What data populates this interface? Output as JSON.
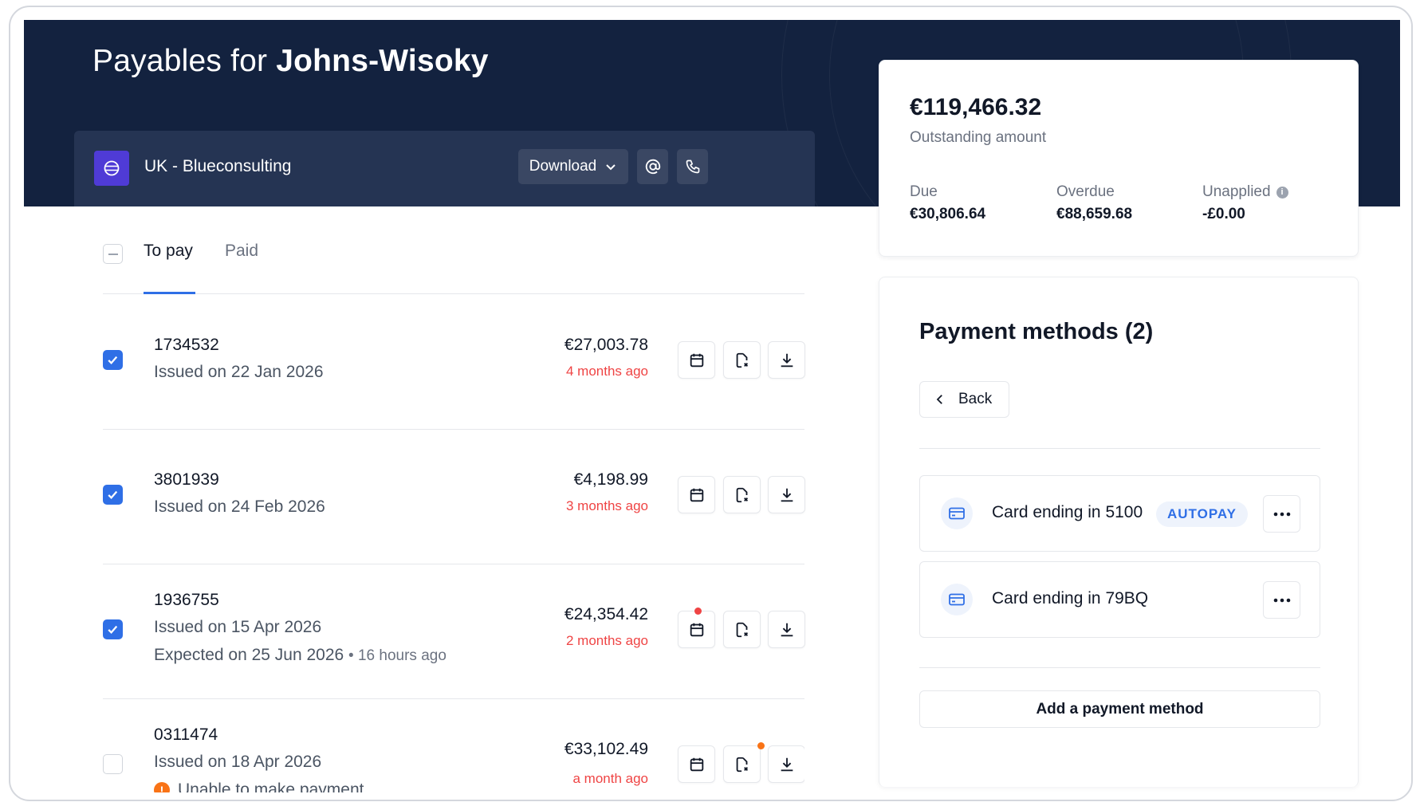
{
  "header": {
    "title_prefix": "Payables for",
    "company": "Johns-Wisoky"
  },
  "entity": {
    "name": "UK - Blueconsulting",
    "download_label": "Download",
    "email_icon": "at-icon",
    "phone_icon": "phone-icon"
  },
  "tabs": [
    {
      "label": "To pay",
      "active": true
    },
    {
      "label": "Paid",
      "active": false
    }
  ],
  "invoices": [
    {
      "number": "1734532",
      "issued": "Issued on 22 Jan 2026",
      "amount": "€27,003.78",
      "ago": "4 months ago",
      "checked": true
    },
    {
      "number": "3801939",
      "issued": "Issued on 24 Feb 2026",
      "amount": "€4,198.99",
      "ago": "3 months ago",
      "checked": true
    },
    {
      "number": "1936755",
      "issued": "Issued on 15 Apr 2026",
      "expected": "Expected on 25 Jun 2026",
      "expected_note": "16 hours ago",
      "amount": "€24,354.42",
      "ago": "2 months ago",
      "checked": true
    },
    {
      "number": "0311474",
      "issued": "Issued on 18 Apr 2026",
      "warning": "Unable to make payment",
      "amount": "€33,102.49",
      "ago": "a month ago",
      "checked": false
    }
  ],
  "summary": {
    "outstanding_amount": "€119,466.32",
    "outstanding_label": "Outstanding amount",
    "due_label": "Due",
    "due_value": "€30,806.64",
    "overdue_label": "Overdue",
    "overdue_value": "€88,659.68",
    "unapplied_label": "Unapplied",
    "unapplied_value": "-£0.00"
  },
  "payment_methods": {
    "title": "Payment methods (2)",
    "back_label": "Back",
    "items": [
      {
        "label": "Card ending in",
        "last4": "5100",
        "badge": "AUTOPAY"
      },
      {
        "label": "Card ending in",
        "last4": "79BQ"
      }
    ],
    "add_label": "Add a payment method"
  },
  "colors": {
    "navy": "#13223f",
    "accent": "#2f6fe6",
    "overdue_red": "#ef4444",
    "notify_orange": "#f97316"
  }
}
